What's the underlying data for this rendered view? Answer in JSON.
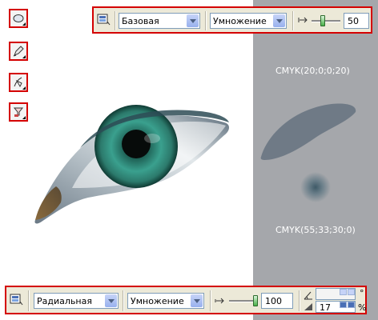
{
  "top_toolbar": {
    "preset": "Базовая",
    "blend_mode": "Умножение",
    "value": "50",
    "slider_fraction": 0.35
  },
  "bottom_toolbar": {
    "type": "Радиальная",
    "blend_mode": "Умножение",
    "value": "100",
    "slider_fraction": 1.0,
    "angle_value": "17",
    "degree_symbol": "°",
    "percent_symbol": "%"
  },
  "canvas": {
    "swatch_top_label": "CMYK(20;0;0;20)",
    "swatch_bottom_label": "CMYK(55;33;30;0)"
  },
  "tools": [
    {
      "name": "ellipse-tool",
      "icon": "ellipse-icon"
    },
    {
      "name": "pen-tool",
      "icon": "pen-icon"
    },
    {
      "name": "bezier-tool",
      "icon": "bezier-icon"
    },
    {
      "name": "transparency-tool",
      "icon": "transparency-icon"
    }
  ],
  "colors": {
    "panel_gray": "#a5a7ab",
    "highlight_border": "#d40000"
  }
}
